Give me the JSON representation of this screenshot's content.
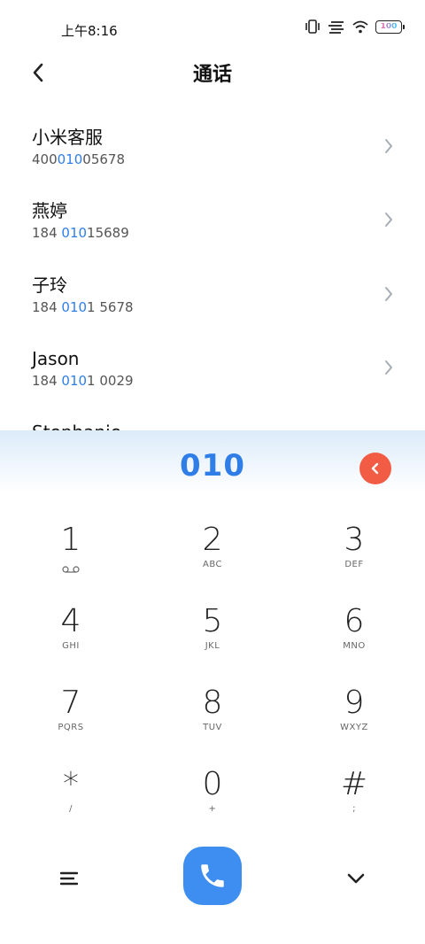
{
  "status_bar": {
    "time": "上午8:16",
    "battery": "100"
  },
  "header": {
    "title": "通话"
  },
  "contacts": [
    {
      "name": "小米客服",
      "number_pre": "400",
      "number_match": "010",
      "number_post": "05678"
    },
    {
      "name": "燕婷",
      "number_pre": "184 ",
      "number_match": "010",
      "number_post": "15689"
    },
    {
      "name": "子玲",
      "number_pre": "184 ",
      "number_match": "010",
      "number_post": "1 5678"
    },
    {
      "name": "Jason",
      "number_pre": "184 ",
      "number_match": "010",
      "number_post": "1 0029"
    },
    {
      "name": "Stephanie",
      "number_pre": "",
      "number_match": "",
      "number_post": ""
    }
  ],
  "dialer": {
    "input": "010",
    "keys": [
      {
        "digit": "1",
        "letters": ""
      },
      {
        "digit": "2",
        "letters": "ABC"
      },
      {
        "digit": "3",
        "letters": "DEF"
      },
      {
        "digit": "4",
        "letters": "GHI"
      },
      {
        "digit": "5",
        "letters": "JKL"
      },
      {
        "digit": "6",
        "letters": "MNO"
      },
      {
        "digit": "7",
        "letters": "PQRS"
      },
      {
        "digit": "8",
        "letters": "TUV"
      },
      {
        "digit": "9",
        "letters": "WXYZ"
      },
      {
        "digit": "*",
        "letters": "/"
      },
      {
        "digit": "0",
        "letters": "+"
      },
      {
        "digit": "#",
        "letters": ";"
      }
    ]
  },
  "colors": {
    "accent": "#2f7ee8",
    "call": "#3d8ef0",
    "delete": "#f25c44"
  }
}
